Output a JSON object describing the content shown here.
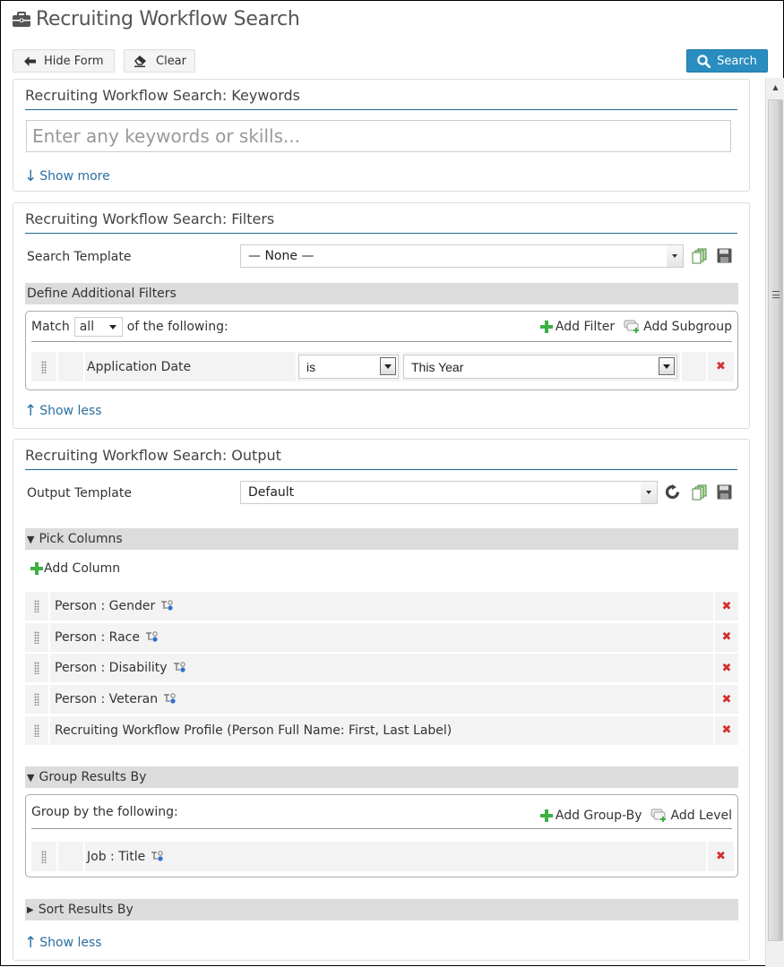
{
  "header": {
    "title": "Recruiting Workflow Search",
    "icon": "briefcase-icon"
  },
  "toolbar": {
    "hide_form": "Hide Form",
    "clear": "Clear",
    "search": "Search"
  },
  "keywords": {
    "title": "Recruiting Workflow Search: Keywords",
    "placeholder": "Enter any keywords or skills...",
    "value": "",
    "show_more": "Show more"
  },
  "filters": {
    "title": "Recruiting Workflow Search: Filters",
    "search_template_label": "Search Template",
    "search_template_value": "— None —",
    "define_label": "Define Additional Filters",
    "match_prefix": "Match",
    "match_value": "all",
    "match_suffix": "of the following:",
    "add_filter": "Add Filter",
    "add_subgroup": "Add Subgroup",
    "rows": [
      {
        "field": "Application Date",
        "operator": "is",
        "value": "This Year"
      }
    ],
    "show_less": "Show less"
  },
  "output": {
    "title": "Recruiting Workflow Search: Output",
    "output_template_label": "Output Template",
    "output_template_value": "Default",
    "pick_columns_label": "Pick Columns",
    "add_column": "Add Column",
    "columns": [
      {
        "label": "Person : Gender",
        "has_relation_icon": true
      },
      {
        "label": "Person : Race",
        "has_relation_icon": true
      },
      {
        "label": "Person : Disability",
        "has_relation_icon": true
      },
      {
        "label": "Person : Veteran",
        "has_relation_icon": true
      },
      {
        "label": "Recruiting Workflow Profile (Person Full Name: First, Last Label)",
        "has_relation_icon": false
      }
    ],
    "group_results_label": "Group Results By",
    "group_by_prefix": "Group by the following:",
    "add_group_by": "Add Group-By",
    "add_level": "Add Level",
    "group_rows": [
      {
        "label": "Job : Title"
      }
    ],
    "sort_results_label": "Sort Results By",
    "show_less": "Show less"
  },
  "colors": {
    "accent": "#2a8dbf",
    "link": "#2a6fa0",
    "rule": "#1c6a8c",
    "delete": "#d23030",
    "add": "#3cb043"
  },
  "scrollbar": {
    "position_fraction": 0.0
  }
}
